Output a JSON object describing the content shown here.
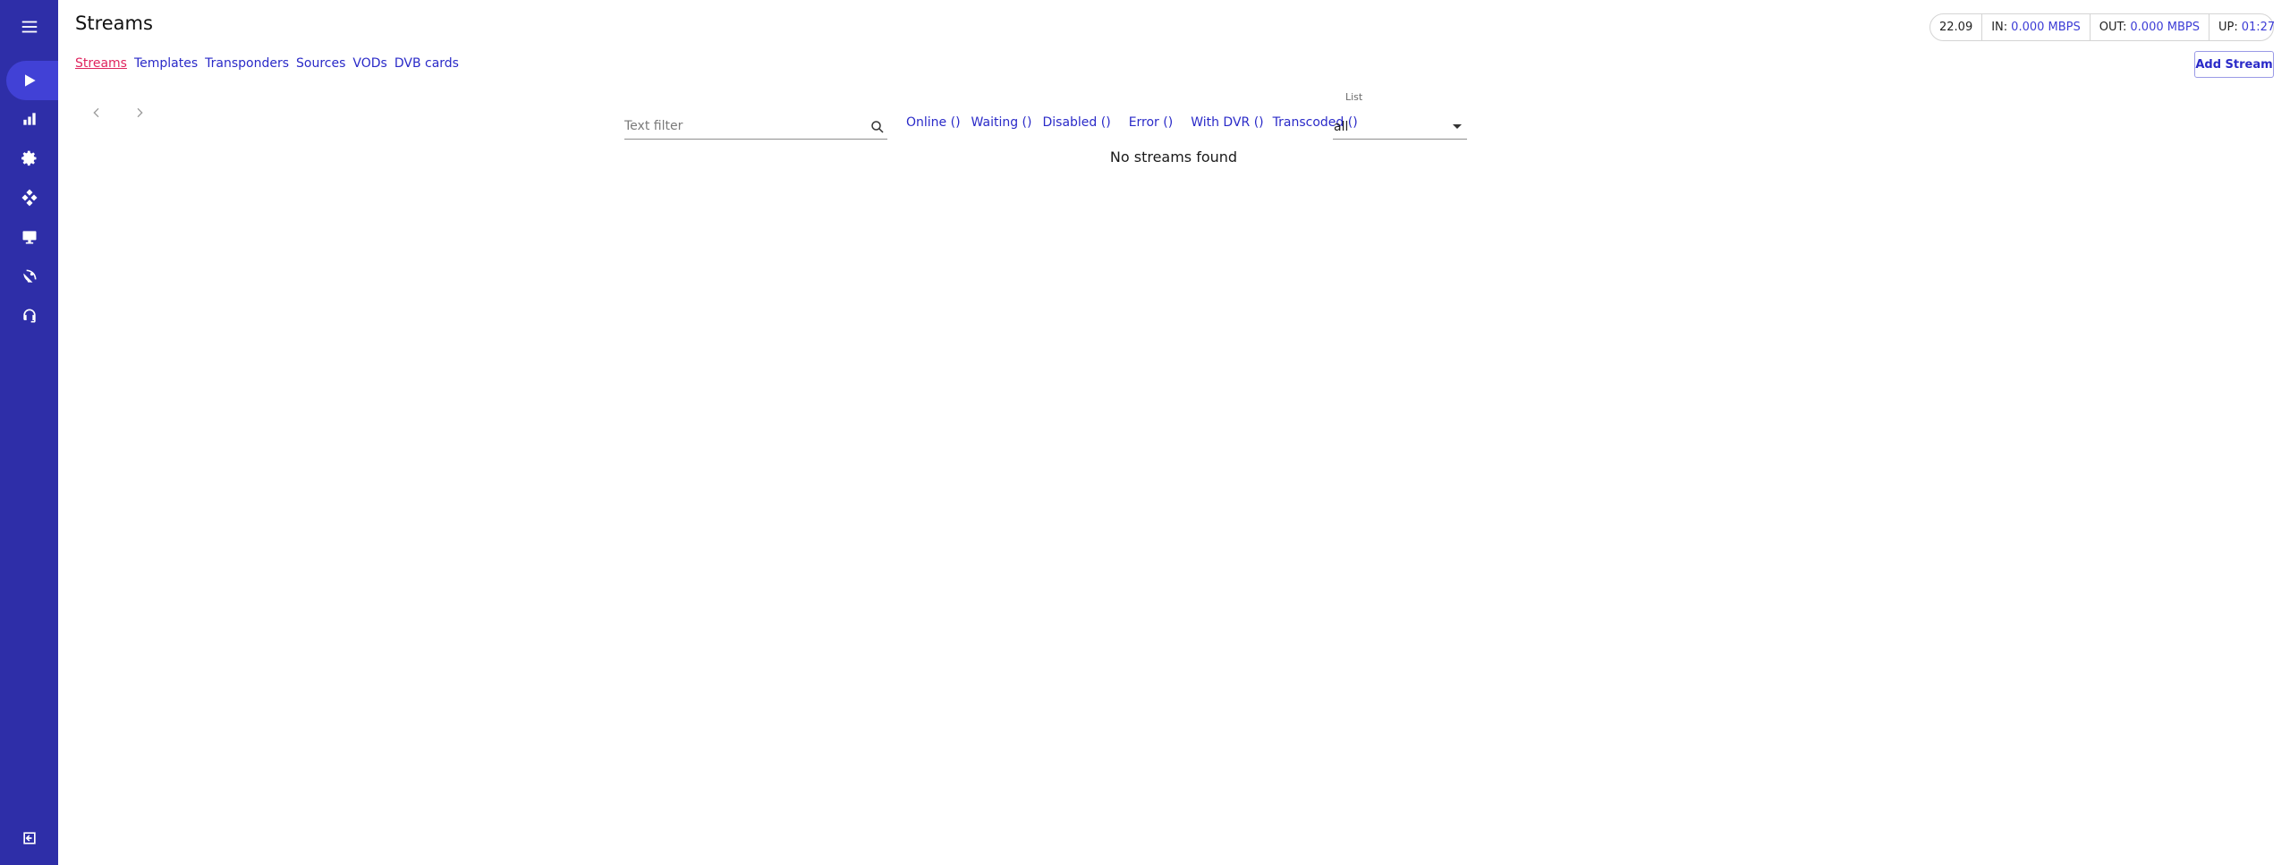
{
  "header": {
    "title": "Streams"
  },
  "stats": {
    "version": "22.09",
    "in_label": "IN:",
    "in_value": "0.000 MBPS",
    "out_label": "OUT:",
    "out_value": "0.000 MBPS",
    "up_label": "UP:",
    "up_value": "01:27"
  },
  "sidebar": {
    "items": [
      {
        "name": "menu-icon"
      },
      {
        "name": "play-icon",
        "active": true
      },
      {
        "name": "bar-chart-icon"
      },
      {
        "name": "gear-icon"
      },
      {
        "name": "cluster-icon"
      },
      {
        "name": "monitor-icon"
      },
      {
        "name": "satellite-dish-icon"
      },
      {
        "name": "headset-icon"
      },
      {
        "name": "logout-icon"
      }
    ]
  },
  "sub_nav": {
    "items": [
      {
        "label": "Streams",
        "active": true
      },
      {
        "label": "Templates"
      },
      {
        "label": "Transponders"
      },
      {
        "label": "Sources"
      },
      {
        "label": "VODs"
      },
      {
        "label": "DVB cards"
      }
    ]
  },
  "toolbar": {
    "add_stream_label": "Add Stream"
  },
  "filters": {
    "text_placeholder": "Text filter",
    "text_value": "",
    "quick": [
      {
        "label": "Online ()"
      },
      {
        "label": "Waiting ()"
      },
      {
        "label": "Disabled ()"
      },
      {
        "label": "Error ()"
      },
      {
        "label": "With DVR ()"
      },
      {
        "label": "Transcoded ()"
      }
    ],
    "list_label": "List",
    "list_value": "all"
  },
  "main": {
    "empty_message": "No streams found"
  },
  "colors": {
    "sidebar_bg": "#2e2ea8",
    "link": "#2a2ac8",
    "active_link": "#e0245e"
  }
}
